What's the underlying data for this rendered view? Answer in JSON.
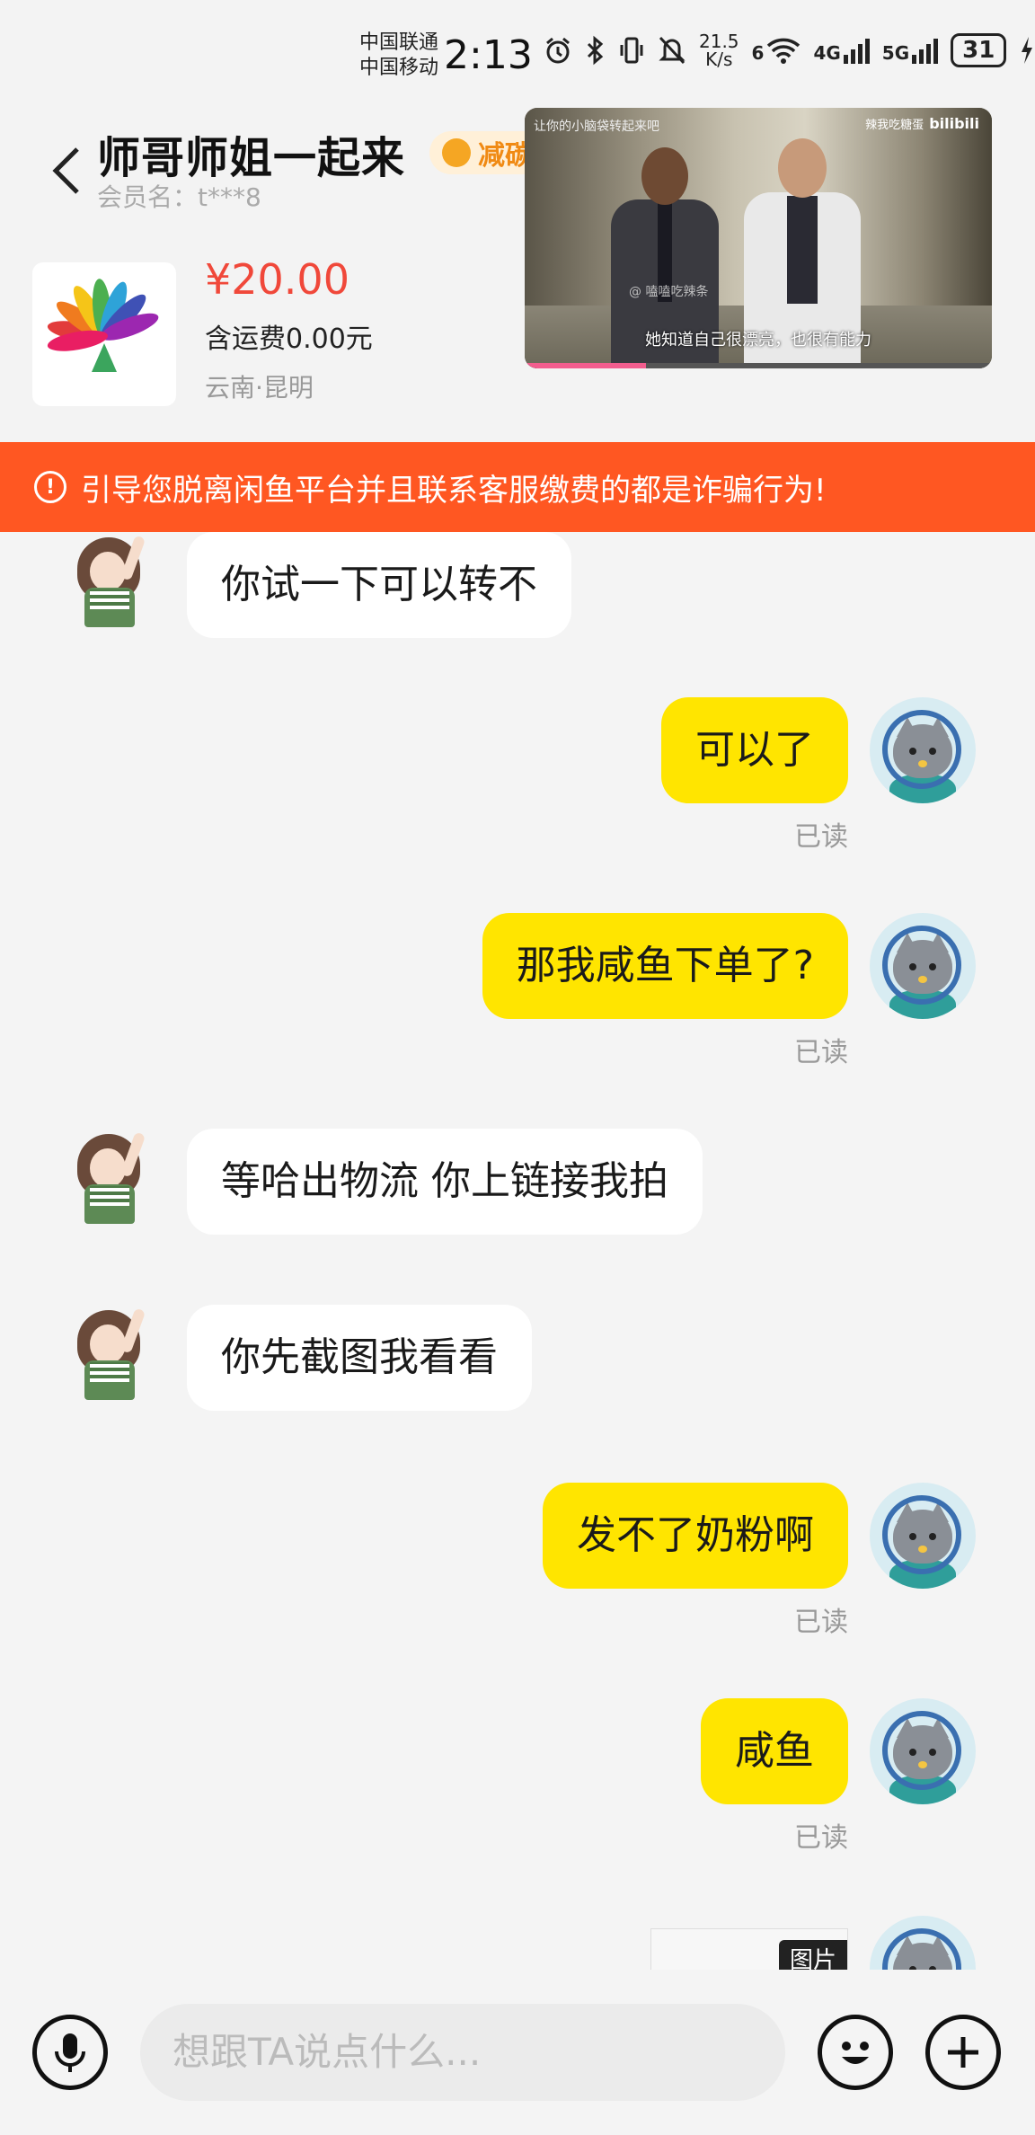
{
  "status_bar": {
    "carrier1": "中国联通",
    "carrier2": "中国移动",
    "time": "2:13",
    "net_speed_value": "21.5",
    "net_speed_unit": "K/s",
    "signal_a": "6",
    "signal_b": "4G",
    "signal_c": "5G",
    "battery": "31"
  },
  "header": {
    "title": "师哥师姐一起来",
    "badge": "减碳",
    "member_name": "会员名：t***8",
    "price": "¥20.00",
    "freight": "含运费0.00元",
    "location": "云南·昆明"
  },
  "video_overlay": {
    "top_left": "让你的小脑袋转起来吧",
    "top_right": "辣我吃糖蛋",
    "brand": "bilibili",
    "watermark": "@ 嗑嗑吃辣条",
    "subtitle": "她知道自己很漂亮，也很有能力",
    "progress": 0.26
  },
  "warning": {
    "text": "引导您脱离闲鱼平台并且联系客服缴费的都是诈骗行为!"
  },
  "messages": [
    {
      "side": "in",
      "text": "你试一下可以转不"
    },
    {
      "side": "out",
      "text": "可以了",
      "status": "已读"
    },
    {
      "side": "out",
      "text": "那我咸鱼下单了?",
      "status": "已读"
    },
    {
      "side": "in",
      "text": "等哈出物流 你上链接我拍"
    },
    {
      "side": "in",
      "text": "你先截图我看看"
    },
    {
      "side": "out",
      "text": "发不了奶粉啊",
      "status": "已读"
    },
    {
      "side": "out",
      "text": "咸鱼",
      "status": "已读"
    },
    {
      "side": "out",
      "type": "image",
      "label": "图片"
    }
  ],
  "input_bar": {
    "placeholder": "想跟TA说点什么..."
  }
}
